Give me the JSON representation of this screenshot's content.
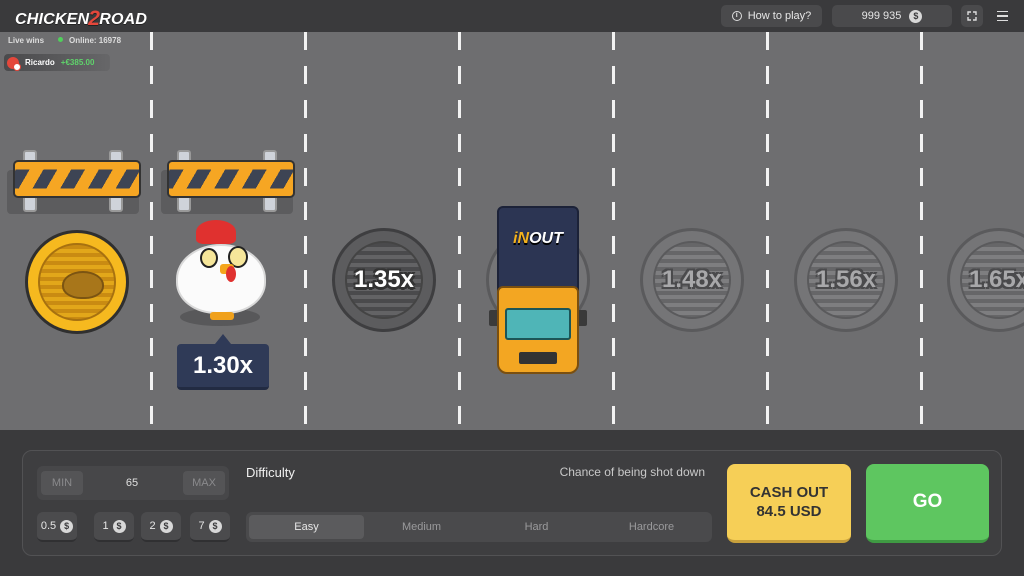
{
  "header": {
    "logo_left": "CHICKEN",
    "logo_num": "2",
    "logo_right": "ROAD",
    "how_to_play": "How to play?",
    "balance": "999 935",
    "currency_icon": "dollar-coin-icon"
  },
  "live": {
    "label": "Live wins",
    "online": "Online: 16978",
    "winner_name": "Ricardo",
    "winner_amount": "+€385.00"
  },
  "lanes": {
    "current_multiplier": "1.30x",
    "multipliers": [
      "1.35x",
      "1.48x",
      "1.56x",
      "1.65x"
    ],
    "truck_brand_a": "iN",
    "truck_brand_b": "OUT"
  },
  "controls": {
    "min": "MIN",
    "bet_value": "65",
    "max": "MAX",
    "chips": [
      "0.5",
      "1",
      "2",
      "7"
    ],
    "difficulty_label": "Difficulty",
    "chance_label": "Chance of being shot down",
    "difficulties": [
      "Easy",
      "Medium",
      "Hard",
      "Hardcore"
    ],
    "selected_difficulty": "Easy",
    "cashout_line1": "CASH OUT",
    "cashout_line2": "84.5 USD",
    "go": "GO"
  },
  "colors": {
    "road": "#6e6e70",
    "cashout": "#f6cf57",
    "go": "#5ec660",
    "accent_red": "#e4473b"
  }
}
